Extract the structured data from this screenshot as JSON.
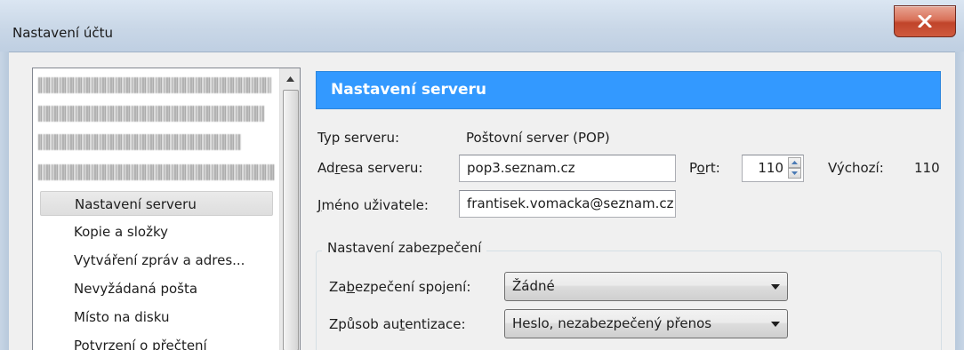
{
  "window": {
    "title": "Nastavení účtu",
    "close_icon": "close-icon"
  },
  "sidebar": {
    "items": [
      {
        "label": "Nastavení serveru",
        "selected": true
      },
      {
        "label": "Kopie a složky",
        "selected": false
      },
      {
        "label": "Vytváření zpráv a adres...",
        "selected": false
      },
      {
        "label": "Nevyžádaná pošta",
        "selected": false
      },
      {
        "label": "Místo na disku",
        "selected": false
      },
      {
        "label": "Potvrzení o přečtení",
        "selected": false
      }
    ]
  },
  "panel": {
    "header": "Nastavení serveru",
    "server_type_label": "Typ serveru:",
    "server_type_value": "Poštovní server (POP)",
    "server_address_label_pre": "Ad",
    "server_address_label_u": "r",
    "server_address_label_post": "esa serveru:",
    "server_address_value": "pop3.seznam.cz",
    "port_label_pre": "P",
    "port_label_u": "o",
    "port_label_post": "rt:",
    "port_value": "110",
    "default_label": "Výchozí:",
    "default_value": "110",
    "username_label_u": "J",
    "username_label_post": "méno uživatele:",
    "username_value": "frantisek.vomacka@seznam.cz"
  },
  "security": {
    "group_title": "Nastavení zabezpečení",
    "connection_label_pre": "Za",
    "connection_label_u": "b",
    "connection_label_post": "ezpečení spojení:",
    "connection_value": "Žádné",
    "auth_label_pre": "Způsob au",
    "auth_label_u": "t",
    "auth_label_post": "entizace:",
    "auth_value": "Heslo, nezabezpečený přenos"
  },
  "colors": {
    "header_bg": "#3399ff",
    "close_button": "#c0442a"
  }
}
